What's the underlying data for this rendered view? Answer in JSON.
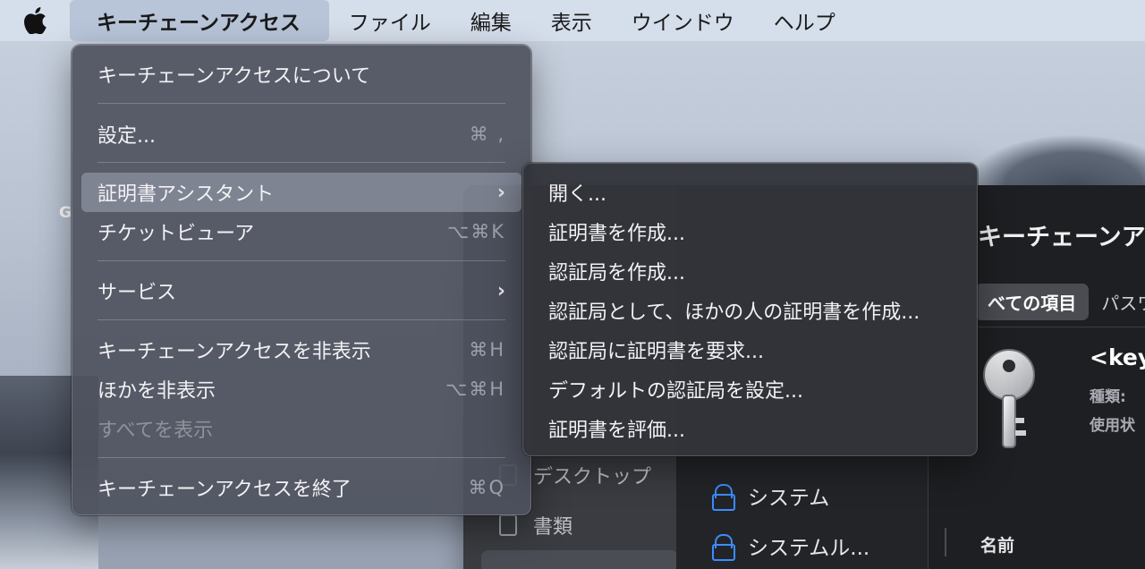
{
  "menubar": {
    "app_menu": "キーチェーンアクセス",
    "items": [
      "ファイル",
      "編集",
      "表示",
      "ウインドウ",
      "ヘルプ"
    ]
  },
  "desktop": {
    "icon_label": "G"
  },
  "app_menu_dropdown": {
    "items": [
      {
        "label": "キーチェーンアクセスについて",
        "shortcut": ""
      },
      {
        "label": "設定...",
        "shortcut": "⌘ ,"
      },
      {
        "label": "証明書アシスタント",
        "shortcut": "",
        "submenu": true
      },
      {
        "label": "チケットビューア",
        "shortcut": "⌥⌘K"
      },
      {
        "label": "サービス",
        "shortcut": "",
        "submenu": true
      },
      {
        "label": "キーチェーンアクセスを非表示",
        "shortcut": "⌘H"
      },
      {
        "label": "ほかを非表示",
        "shortcut": "⌥⌘H"
      },
      {
        "label": "すべてを表示",
        "shortcut": "",
        "disabled": true
      },
      {
        "label": "キーチェーンアクセスを終了",
        "shortcut": "⌘Q"
      }
    ]
  },
  "certificate_assistant_submenu": {
    "items": [
      "開く...",
      "証明書を作成...",
      "認証局を作成...",
      "認証局として、ほかの人の証明書を作成...",
      "認証局に証明書を要求...",
      "デフォルトの認証局を設定...",
      "証明書を評価..."
    ]
  },
  "window": {
    "title": "キーチェーンアク",
    "tabs": [
      "べての項目",
      "パスワ"
    ],
    "sidebar": [
      "デスクトップ",
      "書類"
    ],
    "keychains": [
      "システム",
      "システムル..."
    ],
    "item_name": "<key",
    "meta_kind": "種類:",
    "meta_usage": "使用状",
    "column_name": "名前"
  }
}
